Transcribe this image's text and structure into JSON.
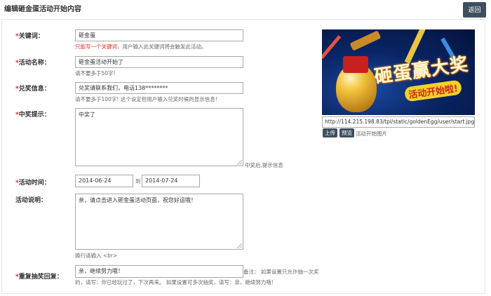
{
  "header": {
    "title": "编辑砸金蛋活动开始内容",
    "back_label": "返回"
  },
  "form": {
    "keyword": {
      "label": "关键词：",
      "value": "砸金蛋",
      "help_red": "只能写一个关键词",
      "help_rest": "，用户输入此关键词将会触发此活动。"
    },
    "activity_name": {
      "label": "活动名称：",
      "value": "砸金蛋活动开始了",
      "help": "请不要多于50字!"
    },
    "prize_info": {
      "label": "兑奖信息：",
      "value": "兑奖请联系我们，电话138********",
      "help": "请不要多于100字! 这个设定但用户输入兑奖时候的显示信息!"
    },
    "win_tip": {
      "label": "中奖提示：",
      "value": "中奖了",
      "side_help": "中奖后,提示信息"
    },
    "activity_time": {
      "label": "活动时间：",
      "start": "2014-06-24",
      "separator": "到",
      "end": "2014-07-24"
    },
    "description": {
      "label": "活动说明：",
      "value": "亲，请点击进入砸金蛋活动页面，祝您好运哦！",
      "help": "换行请输入 <br>"
    },
    "repeat_reply": {
      "label": "重复抽奖回复：",
      "value": "亲，继续努力哦！",
      "note_line1": "备注： 如果设置只允许抽一次奖",
      "note_line2": "的，请写：你已经玩过了，下次再来。 如果设置可多次抽奖，请写：亲，继续努力哦！"
    }
  },
  "image": {
    "poster_title": "砸蛋赢大奖",
    "poster_sub": "活动开始啦!",
    "url": "http://114.215.198.83/tpl/static/goldenEgg/user/start.jpg",
    "upload_label": "上传",
    "preview_label": "预览",
    "caption": "活动开始图片"
  },
  "colors": {
    "button_bg": "#3f4f5f",
    "required_star": "#d9251d",
    "warning_text": "#e0271b"
  }
}
